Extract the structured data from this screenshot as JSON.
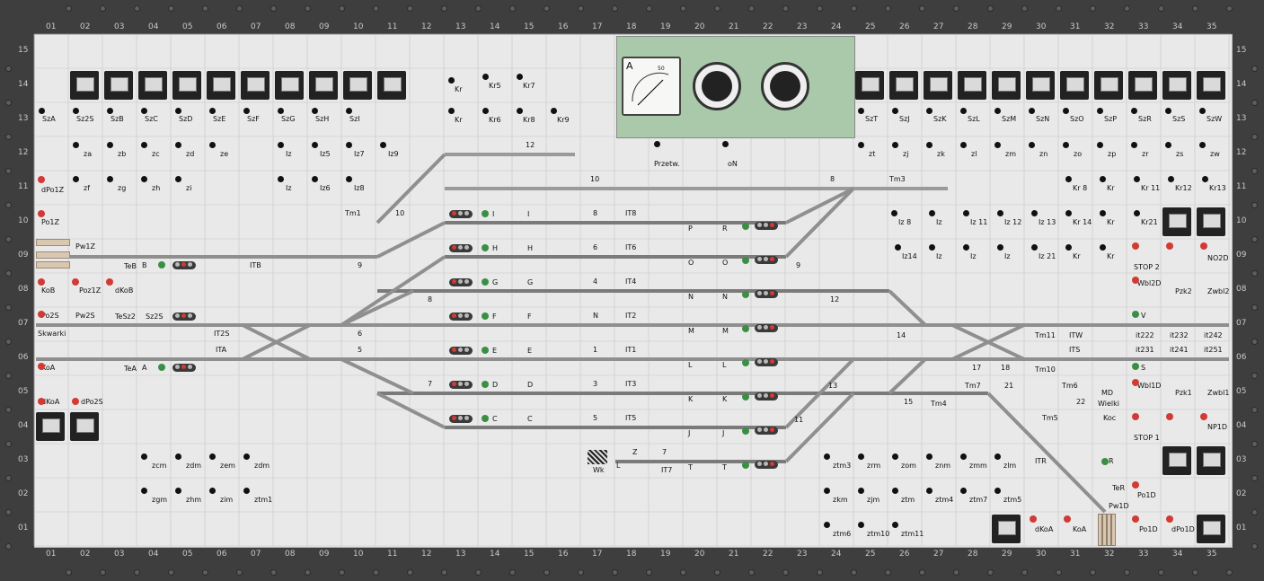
{
  "panel": {
    "title": "",
    "accent_colors": {
      "frame": "#3e3e3e",
      "panel": "#e8e9e8",
      "track": "#8f8f8f",
      "meter_panel": "#a9c9aa"
    },
    "column_numbers": [
      "01",
      "02",
      "03",
      "04",
      "05",
      "06",
      "07",
      "08",
      "09",
      "10",
      "11",
      "12",
      "13",
      "14",
      "15",
      "16",
      "17",
      "18",
      "19",
      "20",
      "21",
      "22",
      "23",
      "24",
      "25",
      "26",
      "27",
      "28",
      "29",
      "30",
      "31",
      "32",
      "33",
      "34",
      "35"
    ],
    "row_numbers": [
      "15",
      "14",
      "13",
      "12",
      "11",
      "10",
      "09",
      "08",
      "07",
      "06",
      "05",
      "04",
      "03",
      "02",
      "01"
    ]
  },
  "labels": {
    "sza": "SzA",
    "sz2s": "Sz2S",
    "szb": "SzB",
    "szc": "SzC",
    "szd": "SzD",
    "sze": "SzE",
    "szf": "SzF",
    "szg": "SzG",
    "szh": "SzH",
    "szi": "SzI",
    "szt": "SzT",
    "szj": "SzJ",
    "szk": "SzK",
    "szl": "SzL",
    "szm": "SzM",
    "szn": "SzN",
    "szo": "SzO",
    "szp": "SzP",
    "szr": "SzR",
    "szs": "SzS",
    "szw": "SzW",
    "za": "za",
    "zb": "zb",
    "zc": "zc",
    "zd": "zd",
    "ze": "ze",
    "zf": "zf",
    "zg": "zg",
    "zh": "zh",
    "zi": "zi",
    "zt": "zt",
    "zj": "zj",
    "zk": "zk",
    "zl": "zl",
    "zm": "zm",
    "zn": "zn",
    "zo": "zo",
    "zp": "zp",
    "zr": "zr",
    "zs": "zs",
    "zw": "zw",
    "po1z": "Po1Z",
    "dpo1z": "dPo1Z",
    "pw1z": "Pw1Z",
    "koa": "KoA",
    "kob": "KoB",
    "po2s": "Po2S",
    "pw2s": "Pw2S",
    "poz1z": "Poz1Z",
    "dkob": "dKoB",
    "skwarki": "Skwarki",
    "tea": "TeA",
    "teb": "TeB",
    "tesz2": "TeSz2",
    "sz2s_b": "Sz2S",
    "b1": "B",
    "a12": "A",
    "it2s": "IT2S",
    "ita": "ITA",
    "itb": "ITB",
    "dkoa": "dKoA",
    "dpo2s": "dPo2S",
    "kr13": "Kr",
    "kr5": "Kr5",
    "kr7": "Kr7",
    "kr24": "Kr",
    "kr6": "Kr6",
    "kr8": "Kr8",
    "kr9": "Kr9",
    "iz13": "Iz",
    "iz5": "Iz5",
    "iz7": "Iz7",
    "iz9": "Iz9",
    "iz24": "Iz",
    "iz6": "Iz6",
    "iz8": "Iz8",
    "tm1": "Tm1",
    "tm3": "Tm3",
    "n12": "12",
    "n10": "10",
    "n10b": "10",
    "n8": "8",
    "n8b": "8",
    "n6": "6",
    "n4": "4",
    "n2": "N",
    "n1": "1",
    "n3": "3",
    "n5": "5",
    "n7": "7",
    "n9": "9",
    "it8": "IT8",
    "it6": "IT6",
    "it4": "IT4",
    "it2": "IT2",
    "it1": "IT1",
    "it3": "IT3",
    "it5": "IT5",
    "it7": "IT7",
    "i1": "I",
    "im": "I",
    "h2": "H",
    "hm": "H",
    "g2": "G",
    "gm": "G",
    "f1": "F",
    "fm": "F",
    "e2": "E",
    "em": "E",
    "d2": "D",
    "dm": "D",
    "c2": "C",
    "cm": "C",
    "pm": "P",
    "r2": "R",
    "om": "O",
    "o2": "O",
    "nm": "N",
    "mm": "M",
    "m12": "M",
    "lm": "L",
    "l12": "L",
    "km": "K",
    "k2": "K",
    "jm": "J",
    "j2": "J",
    "tm": "T",
    "t2": "T",
    "wk": "Wk",
    "z": "Z",
    "l": "L",
    "przetw": "Przetw.",
    "on": "oN",
    "zcm": "zcm",
    "zdm": "zdm",
    "zem": "zem",
    "zgm": "zgm",
    "zhm": "zhm",
    "zim": "zim",
    "ztm1": "ztm1",
    "ztm3": "ztm3",
    "zrm": "zrm",
    "zom": "zom",
    "znm": "znm",
    "zmm": "zmm",
    "zlm": "zlm",
    "zkm": "zkm",
    "zjm": "zjm",
    "ztm": "ztm",
    "ztm4": "ztm4",
    "ztm7": "ztm7",
    "ztm5": "ztm5",
    "ztm6": "ztm6",
    "ztm10": "ztm10",
    "ztm11": "ztm11",
    "iz8b": "Iz 8",
    "iz910": "Iz",
    "iz11": "Iz 11",
    "iz12": "Iz 12",
    "iz13b": "Iz 13",
    "iz14": "Iz14",
    "iz1516": "Iz",
    "iz1719": "Iz",
    "iz1820": "Iz",
    "iz21": "Iz 21",
    "kr8b": "Kr 8",
    "kr910": "Kr",
    "kr11": "Kr 11",
    "kr12": "Kr12",
    "kr13b": "Kr13",
    "kr14": "Kr 14",
    "kr1516": "Kr",
    "kr1719": "Kr",
    "kr1820": "Kr",
    "kr21": "Kr21",
    "stop2": "STOP 2",
    "stop1": "STOP 1",
    "no2d": "NO2D",
    "np1d": "NP1D",
    "wbl2d": "Wbl2D",
    "wbl1d": "Wbl1D",
    "pzk2": "Pzk2",
    "pzk1": "Pzk1",
    "zwbl2": "Zwbl2",
    "zwbl1": "Zwbl1",
    "tm11": "Tm11",
    "tm10": "Tm10",
    "tm7": "Tm7",
    "tm6": "Tm6",
    "tm4": "Tm4",
    "tm5": "Tm5",
    "itw": "ITW",
    "its": "ITS",
    "itr": "ITR",
    "it222": "it222",
    "it232": "it232",
    "it242": "it242",
    "it231": "it231",
    "it241": "it241",
    "it251": "it251",
    "md": "MD",
    "wielki": "Wielki",
    "koc": "Koc",
    "r2b": "R",
    "s12": "S",
    "v12": "V",
    "n14": "14",
    "n13": "13",
    "n11": "11",
    "n21": "21",
    "n22": "22",
    "n1719": "17",
    "n1820": "18",
    "n1516": "15",
    "n910": "9",
    "n8c": "8",
    "tew": "TeR",
    "pw1d": "Pw1D",
    "po1d": "Po1D",
    "dpo1d": "dPo1D",
    "dkoa_r": "dKoA",
    "koa_r": "KoA",
    "po1d_b": "Po1D"
  },
  "meter": {
    "letter": "A",
    "scale_max": "50"
  }
}
